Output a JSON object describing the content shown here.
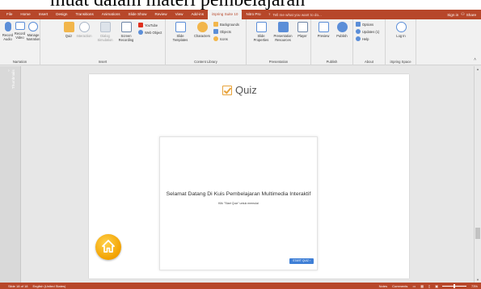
{
  "caption": "muat dalam materi pembelajaran",
  "tabs": [
    "File",
    "Home",
    "Insert",
    "Design",
    "Transitions",
    "Animations",
    "Slide Show",
    "Review",
    "View",
    "Add-ins",
    "iSpring Suite 10",
    "Nitro Pro"
  ],
  "active_tab": "iSpring Suite 10",
  "tell_me": "Tell me what you want to do...",
  "sign_in": "Sign in",
  "share": "Share",
  "ribbon": {
    "narration": {
      "label": "Narration",
      "record_audio": "Record Audio",
      "record_video": "Record Video",
      "manage_narration": "Manage Narration"
    },
    "insert": {
      "label": "Insert",
      "quiz": "Quiz",
      "interaction": "Interaction",
      "dialog_simulation": "Dialog Simulation",
      "screen_recording": "Screen Recording",
      "youtube": "YouTube",
      "web_object": "Web Object"
    },
    "content_library": {
      "label": "Content Library",
      "slide_templates": "Slide Templates",
      "characters": "Characters",
      "backgrounds": "Backgrounds",
      "objects": "Objects",
      "icons": "Icons"
    },
    "presentation": {
      "label": "Presentation",
      "slide_properties": "Slide Properties",
      "presentation_resources": "Presentation Resources",
      "player": "Player"
    },
    "publish": {
      "label": "Publish",
      "preview": "Preview",
      "publish": "Publish"
    },
    "about": {
      "label": "About",
      "options": "Options",
      "updates": "Updates (1)",
      "help": "Help"
    },
    "ispring_space": {
      "label": "iSpring Space",
      "log_in": "Log In"
    }
  },
  "side_panel_label": "Thumbnails",
  "slide": {
    "quiz_title": "Quiz",
    "card_title": "Selamat Datang Di Kuis Pembelajaran Multimedia Interaktif",
    "card_subtitle": "Klik \"Start Quiz\" untuk memulai",
    "start_button": "START QUIZ"
  },
  "status": {
    "slide_info": "Slide 18 of 18",
    "language": "English (United States)",
    "notes": "Notes",
    "comments": "Comments",
    "zoom": "73%"
  },
  "colors": {
    "accent": "#b7472a",
    "quiz_icon": "#e8a33b",
    "start_button": "#3f7fd6",
    "home_button": "#f2a100"
  }
}
